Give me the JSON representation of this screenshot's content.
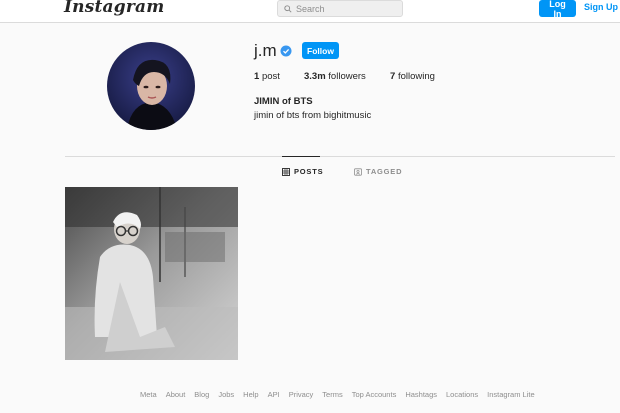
{
  "nav": {
    "logo": "Instagram",
    "search_placeholder": "Search",
    "login_label": "Log In",
    "signup_label": "Sign Up"
  },
  "profile": {
    "username": "j.m",
    "verified": true,
    "follow_label": "Follow",
    "posts_count": "1",
    "posts_label": "post",
    "followers_count": "3.3m",
    "followers_label": "followers",
    "following_count": "7",
    "following_label": "following",
    "full_name": "JIMIN of BTS",
    "bio": "jimin of bts from bighitmusic"
  },
  "tabs": [
    {
      "label": "POSTS",
      "active": true
    },
    {
      "label": "TAGGED",
      "active": false
    }
  ],
  "footer": {
    "links": [
      "Meta",
      "About",
      "Blog",
      "Jobs",
      "Help",
      "API",
      "Privacy",
      "Terms",
      "Top Accounts",
      "Hashtags",
      "Locations",
      "Instagram Lite"
    ]
  },
  "colors": {
    "accent": "#0095f6",
    "background": "#fafafa",
    "text": "#262626",
    "muted": "#8e8e8e",
    "border": "#dbdbdb"
  },
  "icons": [
    "search-icon",
    "verified-badge-icon",
    "grid-icon",
    "tag-icon"
  ]
}
